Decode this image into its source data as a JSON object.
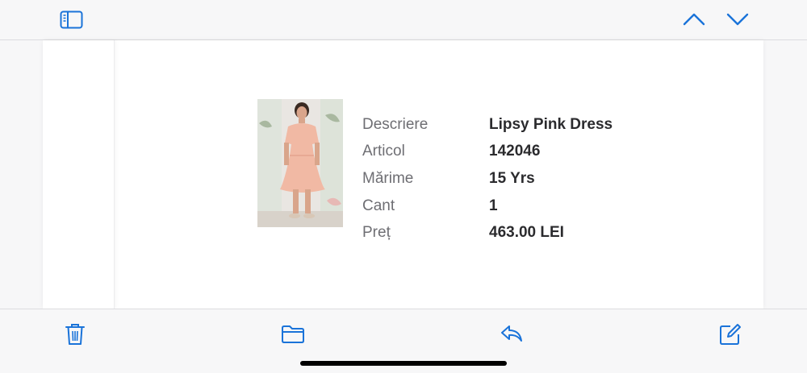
{
  "toolbar": {
    "icons": [
      "sidebar-icon",
      "chevron-up-icon",
      "chevron-down-icon"
    ],
    "accent": "#1a73d9"
  },
  "order_item": {
    "image": "pink-dress-photo",
    "rows": [
      {
        "label": "Descriere",
        "value": "Lipsy Pink Dress"
      },
      {
        "label": "Articol",
        "value": "142046"
      },
      {
        "label": "Mărime",
        "value": "15 Yrs"
      },
      {
        "label": "Cant",
        "value": "1"
      },
      {
        "label": "Preț",
        "value": "463.00 LEI"
      }
    ]
  },
  "bottom_toolbar": {
    "icons": [
      "trash-icon",
      "folder-icon",
      "reply-icon",
      "compose-icon"
    ]
  }
}
